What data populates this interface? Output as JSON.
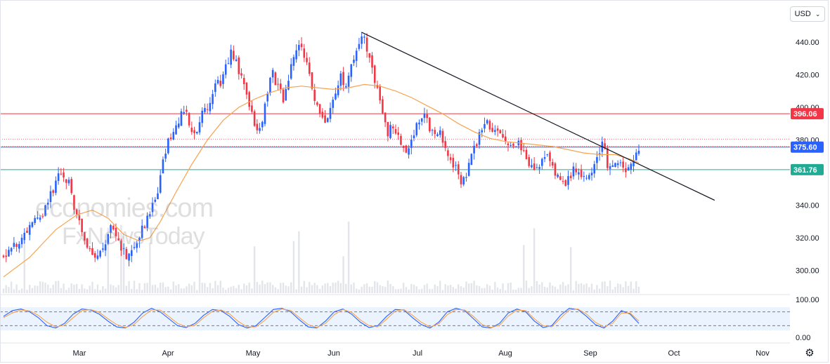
{
  "header": {
    "currency": "USD",
    "currency_chevron": "chevron-down-icon"
  },
  "watermark": {
    "line1": "economies.com",
    "line2": "FxNewsToday"
  },
  "settings_icon": "gear-icon",
  "chart_data": {
    "type": "candlestick",
    "currency": "USD",
    "y_axis": {
      "ylim": [
        290,
        450
      ],
      "ticks": [
        "440.00",
        "420.00",
        "400.00",
        "380.00",
        "340.00",
        "320.00",
        "300.00"
      ]
    },
    "x_axis": {
      "labels": [
        "Mar",
        "Apr",
        "May",
        "Jun",
        "Jul",
        "Aug",
        "Sep",
        "Oct",
        "Nov"
      ]
    },
    "price_path": [
      [
        0,
        310
      ],
      [
        3,
        312
      ],
      [
        6,
        318
      ],
      [
        9,
        325
      ],
      [
        12,
        330
      ],
      [
        16,
        338
      ],
      [
        19,
        350
      ],
      [
        21,
        359
      ],
      [
        23,
        357
      ],
      [
        25,
        354
      ],
      [
        27,
        340
      ],
      [
        29,
        328
      ],
      [
        31,
        319
      ],
      [
        33,
        313
      ],
      [
        35,
        306
      ],
      [
        37,
        310
      ],
      [
        39,
        318
      ],
      [
        41,
        325
      ],
      [
        43,
        323
      ],
      [
        45,
        315
      ],
      [
        47,
        308
      ],
      [
        49,
        313
      ],
      [
        51,
        319
      ],
      [
        53,
        326
      ],
      [
        55,
        332
      ],
      [
        57,
        342
      ],
      [
        59,
        350
      ],
      [
        61,
        368
      ],
      [
        63,
        379
      ],
      [
        65,
        382
      ],
      [
        67,
        393
      ],
      [
        69,
        399
      ],
      [
        71,
        390
      ],
      [
        73,
        383
      ],
      [
        75,
        392
      ],
      [
        77,
        398
      ],
      [
        79,
        405
      ],
      [
        81,
        412
      ],
      [
        83,
        416
      ],
      [
        85,
        424
      ],
      [
        87,
        434
      ],
      [
        89,
        428
      ],
      [
        91,
        418
      ],
      [
        93,
        409
      ],
      [
        95,
        397
      ],
      [
        97,
        386
      ],
      [
        99,
        393
      ],
      [
        101,
        411
      ],
      [
        103,
        420
      ],
      [
        105,
        412
      ],
      [
        107,
        406
      ],
      [
        109,
        418
      ],
      [
        111,
        430
      ],
      [
        113,
        436
      ],
      [
        115,
        432
      ],
      [
        117,
        418
      ],
      [
        119,
        405
      ],
      [
        121,
        398
      ],
      [
        123,
        388
      ],
      [
        125,
        397
      ],
      [
        127,
        410
      ],
      [
        129,
        419
      ],
      [
        131,
        414
      ],
      [
        133,
        425
      ],
      [
        135,
        434
      ],
      [
        137,
        446
      ],
      [
        139,
        437
      ],
      [
        141,
        425
      ],
      [
        143,
        410
      ],
      [
        145,
        396
      ],
      [
        147,
        385
      ],
      [
        149,
        389
      ],
      [
        151,
        381
      ],
      [
        153,
        376
      ],
      [
        155,
        373
      ],
      [
        157,
        383
      ],
      [
        159,
        393
      ],
      [
        161,
        397
      ],
      [
        163,
        388
      ],
      [
        165,
        381
      ],
      [
        167,
        386
      ],
      [
        169,
        376
      ],
      [
        171,
        368
      ],
      [
        173,
        362
      ],
      [
        175,
        355
      ],
      [
        177,
        360
      ],
      [
        179,
        372
      ],
      [
        181,
        378
      ],
      [
        183,
        388
      ],
      [
        185,
        391
      ],
      [
        187,
        385
      ],
      [
        189,
        388
      ],
      [
        191,
        381
      ],
      [
        193,
        374
      ],
      [
        195,
        379
      ],
      [
        197,
        377
      ],
      [
        199,
        373
      ],
      [
        201,
        366
      ],
      [
        203,
        361
      ],
      [
        205,
        364
      ],
      [
        207,
        370
      ],
      [
        209,
        367
      ],
      [
        211,
        358
      ],
      [
        213,
        354
      ],
      [
        215,
        351
      ],
      [
        217,
        359
      ],
      [
        219,
        363
      ],
      [
        221,
        360
      ],
      [
        223,
        358
      ],
      [
        225,
        357
      ],
      [
        227,
        368
      ],
      [
        229,
        380
      ],
      [
        231,
        364
      ],
      [
        233,
        362
      ],
      [
        235,
        366
      ],
      [
        237,
        363
      ],
      [
        239,
        362
      ],
      [
        241,
        365
      ],
      [
        243,
        375.6
      ]
    ],
    "moving_average": {
      "type": "line",
      "color": "#f7a350",
      "points": [
        [
          0,
          296
        ],
        [
          10,
          308
        ],
        [
          20,
          325
        ],
        [
          28,
          334
        ],
        [
          34,
          337
        ],
        [
          40,
          332
        ],
        [
          46,
          322
        ],
        [
          52,
          318
        ],
        [
          56,
          320
        ],
        [
          60,
          330
        ],
        [
          66,
          348
        ],
        [
          72,
          365
        ],
        [
          78,
          380
        ],
        [
          84,
          392
        ],
        [
          90,
          400
        ],
        [
          96,
          405
        ],
        [
          102,
          409
        ],
        [
          108,
          412
        ],
        [
          114,
          413
        ],
        [
          120,
          412
        ],
        [
          126,
          411
        ],
        [
          132,
          412
        ],
        [
          138,
          414
        ],
        [
          144,
          413
        ],
        [
          150,
          410
        ],
        [
          156,
          406
        ],
        [
          162,
          401
        ],
        [
          168,
          396
        ],
        [
          174,
          390
        ],
        [
          180,
          385
        ],
        [
          186,
          381
        ],
        [
          192,
          379
        ],
        [
          198,
          378
        ],
        [
          204,
          377
        ],
        [
          210,
          376
        ],
        [
          216,
          374
        ],
        [
          222,
          372
        ],
        [
          228,
          371
        ],
        [
          234,
          371
        ],
        [
          240,
          368
        ],
        [
          243,
          366
        ]
      ]
    },
    "horizontal_levels": [
      {
        "value": 396.06,
        "label": "396.06",
        "color": "#f23645"
      },
      {
        "value": 375.6,
        "label": "375.60",
        "color": "#2962ff"
      },
      {
        "value": 361.76,
        "label": "361.76",
        "color": "#22ab94"
      }
    ],
    "dotted_levels": [
      {
        "value": 380.5,
        "color": "#f23645"
      },
      {
        "value": 376,
        "color": "#f23645"
      }
    ],
    "trendline": {
      "start": [
        137,
        446
      ],
      "end": [
        272,
        343
      ],
      "color": "#131722"
    },
    "oscillator": {
      "type": "line",
      "ylim": [
        0,
        100
      ],
      "ticks": [
        "100.00",
        "0.00"
      ],
      "levels": [
        80,
        20
      ],
      "series": [
        {
          "color": "#2962ff",
          "values": [
            60,
            85,
            92,
            80,
            55,
            20,
            10,
            30,
            70,
            92,
            88,
            70,
            40,
            15,
            10,
            35,
            75,
            95,
            80,
            50,
            20,
            12,
            30,
            65,
            90,
            85,
            60,
            25,
            10,
            20,
            55,
            90,
            95,
            80,
            45,
            15,
            10,
            40,
            80,
            92,
            70,
            35,
            12,
            20,
            60,
            90,
            88,
            55,
            25,
            10,
            35,
            80,
            95,
            85,
            50,
            15,
            10,
            30,
            75,
            92,
            80,
            40,
            12,
            20,
            65,
            95,
            90,
            60,
            25,
            10,
            40,
            85,
            70,
            30
          ]
        },
        {
          "color": "#f7a350",
          "values": [
            55,
            75,
            88,
            84,
            65,
            35,
            15,
            22,
            55,
            85,
            90,
            78,
            50,
            25,
            12,
            25,
            60,
            88,
            88,
            60,
            30,
            15,
            22,
            55,
            82,
            88,
            70,
            38,
            15,
            15,
            42,
            78,
            92,
            86,
            55,
            25,
            12,
            30,
            68,
            90,
            78,
            45,
            20,
            15,
            48,
            82,
            90,
            65,
            35,
            15,
            28,
            68,
            90,
            88,
            60,
            25,
            12,
            22,
            62,
            88,
            85,
            50,
            20,
            15,
            52,
            88,
            92,
            70,
            35,
            15,
            30,
            75,
            75,
            40
          ]
        }
      ]
    }
  }
}
